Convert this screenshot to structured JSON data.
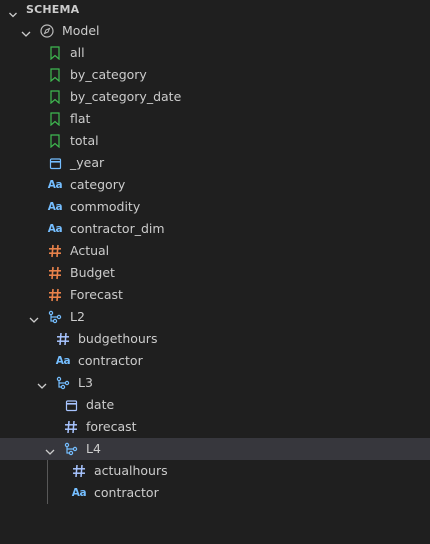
{
  "section": {
    "title": "SCHEMA"
  },
  "tree": {
    "root": {
      "label": "Model",
      "icon": "compass-icon"
    },
    "items": [
      {
        "label": "all",
        "icon": "bookmark-icon"
      },
      {
        "label": "by_category",
        "icon": "bookmark-icon"
      },
      {
        "label": "by_category_date",
        "icon": "bookmark-icon"
      },
      {
        "label": "flat",
        "icon": "bookmark-icon"
      },
      {
        "label": "total",
        "icon": "bookmark-icon"
      },
      {
        "label": "_year",
        "icon": "calendar-icon"
      },
      {
        "label": "category",
        "icon": "text-type-icon",
        "icon_text": "Aa"
      },
      {
        "label": "commodity",
        "icon": "text-type-icon",
        "icon_text": "Aa"
      },
      {
        "label": "contractor_dim",
        "icon": "text-type-icon",
        "icon_text": "Aa"
      },
      {
        "label": "Actual",
        "icon": "hash-icon"
      },
      {
        "label": "Budget",
        "icon": "hash-icon"
      },
      {
        "label": "Forecast",
        "icon": "hash-icon"
      }
    ],
    "l2": {
      "label": "L2",
      "icon": "hierarchy-icon",
      "children": [
        {
          "label": "budgethours",
          "icon": "hash-icon"
        },
        {
          "label": "contractor",
          "icon": "text-type-icon",
          "icon_text": "Aa"
        }
      ],
      "l3": {
        "label": "L3",
        "icon": "hierarchy-icon",
        "children": [
          {
            "label": "date",
            "icon": "calendar-icon"
          },
          {
            "label": "forecast",
            "icon": "hash-icon"
          }
        ],
        "l4": {
          "label": "L4",
          "icon": "hierarchy-icon",
          "selected": true,
          "children": [
            {
              "label": "actualhours",
              "icon": "hash-icon"
            },
            {
              "label": "contractor",
              "icon": "text-type-icon",
              "icon_text": "Aa"
            }
          ]
        }
      }
    }
  },
  "colors": {
    "background": "#1f1f1f",
    "selected_row": "#37373d",
    "bookmark": "#3fb950",
    "calendar": "#75beff",
    "text_type": "#75beff",
    "hash_measure": "#e8824b",
    "hash_nested": "#a8c4ff",
    "hierarchy": "#75beff"
  }
}
